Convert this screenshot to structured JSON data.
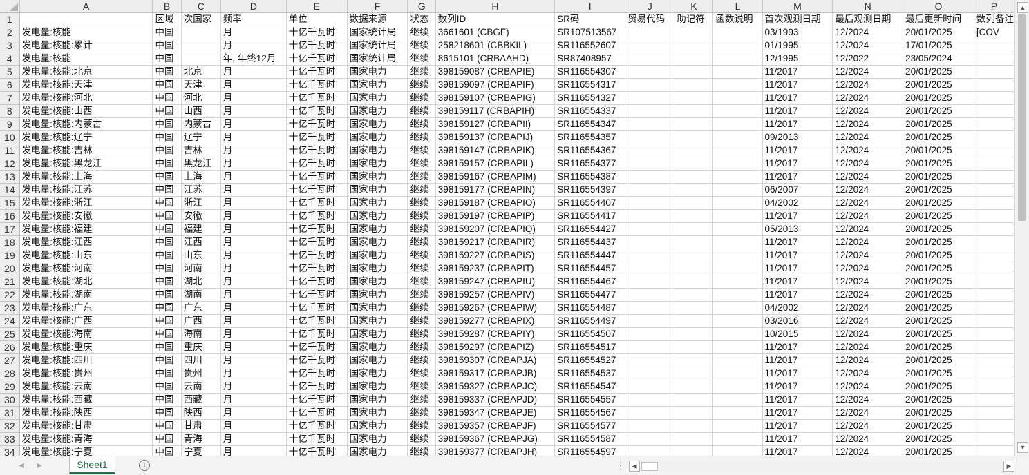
{
  "columns": [
    "A",
    "B",
    "C",
    "D",
    "E",
    "F",
    "G",
    "H",
    "I",
    "J",
    "K",
    "L",
    "M",
    "N",
    "O",
    "P"
  ],
  "rows": [
    [
      "",
      "区域",
      "次国家",
      "频率",
      "单位",
      "数据来源",
      "状态",
      "数列ID",
      "SR码",
      "贸易代码",
      "助记符",
      "函数说明",
      "首次观测日期",
      "最后观测日期",
      "最后更新时间",
      "数列备注"
    ],
    [
      "发电量:核能",
      "中国",
      "",
      "月",
      "十亿千瓦时",
      "国家统计局",
      "继续",
      "3661601 (CBGF)",
      "SR107513567",
      "",
      "",
      "",
      "03/1993",
      "12/2024",
      "20/01/2025",
      "[COV"
    ],
    [
      "发电量:核能:累计",
      "中国",
      "",
      "月",
      "十亿千瓦时",
      "国家统计局",
      "继续",
      "258218601 (CBBKIL)",
      "SR116552607",
      "",
      "",
      "",
      "01/1995",
      "12/2024",
      "17/01/2025",
      ""
    ],
    [
      "发电量:核能",
      "中国",
      "",
      "年, 年终12月",
      "十亿千瓦时",
      "国家统计局",
      "继续",
      "8615101 (CRBAAHD)",
      "SR87408957",
      "",
      "",
      "",
      "12/1995",
      "12/2022",
      "23/05/2024",
      ""
    ],
    [
      "发电量:核能:北京",
      "中国",
      "北京",
      "月",
      "十亿千瓦时",
      "国家电力",
      "继续",
      "398159087 (CRBAPIE)",
      "SR116554307",
      "",
      "",
      "",
      "11/2017",
      "12/2024",
      "20/01/2025",
      ""
    ],
    [
      "发电量:核能:天津",
      "中国",
      "天津",
      "月",
      "十亿千瓦时",
      "国家电力",
      "继续",
      "398159097 (CRBAPIF)",
      "SR116554317",
      "",
      "",
      "",
      "11/2017",
      "12/2024",
      "20/01/2025",
      ""
    ],
    [
      "发电量:核能:河北",
      "中国",
      "河北",
      "月",
      "十亿千瓦时",
      "国家电力",
      "继续",
      "398159107 (CRBAPIG)",
      "SR116554327",
      "",
      "",
      "",
      "11/2017",
      "12/2024",
      "20/01/2025",
      ""
    ],
    [
      "发电量:核能:山西",
      "中国",
      "山西",
      "月",
      "十亿千瓦时",
      "国家电力",
      "继续",
      "398159117 (CRBAPIH)",
      "SR116554337",
      "",
      "",
      "",
      "11/2017",
      "12/2024",
      "20/01/2025",
      ""
    ],
    [
      "发电量:核能:内蒙古",
      "中国",
      "内蒙古",
      "月",
      "十亿千瓦时",
      "国家电力",
      "继续",
      "398159127 (CRBAPII)",
      "SR116554347",
      "",
      "",
      "",
      "11/2017",
      "12/2024",
      "20/01/2025",
      ""
    ],
    [
      "发电量:核能:辽宁",
      "中国",
      "辽宁",
      "月",
      "十亿千瓦时",
      "国家电力",
      "继续",
      "398159137 (CRBAPIJ)",
      "SR116554357",
      "",
      "",
      "",
      "09/2013",
      "12/2024",
      "20/01/2025",
      ""
    ],
    [
      "发电量:核能:吉林",
      "中国",
      "吉林",
      "月",
      "十亿千瓦时",
      "国家电力",
      "继续",
      "398159147 (CRBAPIK)",
      "SR116554367",
      "",
      "",
      "",
      "11/2017",
      "12/2024",
      "20/01/2025",
      ""
    ],
    [
      "发电量:核能:黑龙江",
      "中国",
      "黑龙江",
      "月",
      "十亿千瓦时",
      "国家电力",
      "继续",
      "398159157 (CRBAPIL)",
      "SR116554377",
      "",
      "",
      "",
      "11/2017",
      "12/2024",
      "20/01/2025",
      ""
    ],
    [
      "发电量:核能:上海",
      "中国",
      "上海",
      "月",
      "十亿千瓦时",
      "国家电力",
      "继续",
      "398159167 (CRBAPIM)",
      "SR116554387",
      "",
      "",
      "",
      "11/2017",
      "12/2024",
      "20/01/2025",
      ""
    ],
    [
      "发电量:核能:江苏",
      "中国",
      "江苏",
      "月",
      "十亿千瓦时",
      "国家电力",
      "继续",
      "398159177 (CRBAPIN)",
      "SR116554397",
      "",
      "",
      "",
      "06/2007",
      "12/2024",
      "20/01/2025",
      ""
    ],
    [
      "发电量:核能:浙江",
      "中国",
      "浙江",
      "月",
      "十亿千瓦时",
      "国家电力",
      "继续",
      "398159187 (CRBAPIO)",
      "SR116554407",
      "",
      "",
      "",
      "04/2002",
      "12/2024",
      "20/01/2025",
      ""
    ],
    [
      "发电量:核能:安徽",
      "中国",
      "安徽",
      "月",
      "十亿千瓦时",
      "国家电力",
      "继续",
      "398159197 (CRBAPIP)",
      "SR116554417",
      "",
      "",
      "",
      "11/2017",
      "12/2024",
      "20/01/2025",
      ""
    ],
    [
      "发电量:核能:福建",
      "中国",
      "福建",
      "月",
      "十亿千瓦时",
      "国家电力",
      "继续",
      "398159207 (CRBAPIQ)",
      "SR116554427",
      "",
      "",
      "",
      "05/2013",
      "12/2024",
      "20/01/2025",
      ""
    ],
    [
      "发电量:核能:江西",
      "中国",
      "江西",
      "月",
      "十亿千瓦时",
      "国家电力",
      "继续",
      "398159217 (CRBAPIR)",
      "SR116554437",
      "",
      "",
      "",
      "11/2017",
      "12/2024",
      "20/01/2025",
      ""
    ],
    [
      "发电量:核能:山东",
      "中国",
      "山东",
      "月",
      "十亿千瓦时",
      "国家电力",
      "继续",
      "398159227 (CRBAPIS)",
      "SR116554447",
      "",
      "",
      "",
      "11/2017",
      "12/2024",
      "20/01/2025",
      ""
    ],
    [
      "发电量:核能:河南",
      "中国",
      "河南",
      "月",
      "十亿千瓦时",
      "国家电力",
      "继续",
      "398159237 (CRBAPIT)",
      "SR116554457",
      "",
      "",
      "",
      "11/2017",
      "12/2024",
      "20/01/2025",
      ""
    ],
    [
      "发电量:核能:湖北",
      "中国",
      "湖北",
      "月",
      "十亿千瓦时",
      "国家电力",
      "继续",
      "398159247 (CRBAPIU)",
      "SR116554467",
      "",
      "",
      "",
      "11/2017",
      "12/2024",
      "20/01/2025",
      ""
    ],
    [
      "发电量:核能:湖南",
      "中国",
      "湖南",
      "月",
      "十亿千瓦时",
      "国家电力",
      "继续",
      "398159257 (CRBAPIV)",
      "SR116554477",
      "",
      "",
      "",
      "11/2017",
      "12/2024",
      "20/01/2025",
      ""
    ],
    [
      "发电量:核能:广东",
      "中国",
      "广东",
      "月",
      "十亿千瓦时",
      "国家电力",
      "继续",
      "398159267 (CRBAPIW)",
      "SR116554487",
      "",
      "",
      "",
      "04/2002",
      "12/2024",
      "20/01/2025",
      ""
    ],
    [
      "发电量:核能:广西",
      "中国",
      "广西",
      "月",
      "十亿千瓦时",
      "国家电力",
      "继续",
      "398159277 (CRBAPIX)",
      "SR116554497",
      "",
      "",
      "",
      "03/2016",
      "12/2024",
      "20/01/2025",
      ""
    ],
    [
      "发电量:核能:海南",
      "中国",
      "海南",
      "月",
      "十亿千瓦时",
      "国家电力",
      "继续",
      "398159287 (CRBAPIY)",
      "SR116554507",
      "",
      "",
      "",
      "10/2015",
      "12/2024",
      "20/01/2025",
      ""
    ],
    [
      "发电量:核能:重庆",
      "中国",
      "重庆",
      "月",
      "十亿千瓦时",
      "国家电力",
      "继续",
      "398159297 (CRBAPIZ)",
      "SR116554517",
      "",
      "",
      "",
      "11/2017",
      "12/2024",
      "20/01/2025",
      ""
    ],
    [
      "发电量:核能:四川",
      "中国",
      "四川",
      "月",
      "十亿千瓦时",
      "国家电力",
      "继续",
      "398159307 (CRBAPJA)",
      "SR116554527",
      "",
      "",
      "",
      "11/2017",
      "12/2024",
      "20/01/2025",
      ""
    ],
    [
      "发电量:核能:贵州",
      "中国",
      "贵州",
      "月",
      "十亿千瓦时",
      "国家电力",
      "继续",
      "398159317 (CRBAPJB)",
      "SR116554537",
      "",
      "",
      "",
      "11/2017",
      "12/2024",
      "20/01/2025",
      ""
    ],
    [
      "发电量:核能:云南",
      "中国",
      "云南",
      "月",
      "十亿千瓦时",
      "国家电力",
      "继续",
      "398159327 (CRBAPJC)",
      "SR116554547",
      "",
      "",
      "",
      "11/2017",
      "12/2024",
      "20/01/2025",
      ""
    ],
    [
      "发电量:核能:西藏",
      "中国",
      "西藏",
      "月",
      "十亿千瓦时",
      "国家电力",
      "继续",
      "398159337 (CRBAPJD)",
      "SR116554557",
      "",
      "",
      "",
      "11/2017",
      "12/2024",
      "20/01/2025",
      ""
    ],
    [
      "发电量:核能:陕西",
      "中国",
      "陕西",
      "月",
      "十亿千瓦时",
      "国家电力",
      "继续",
      "398159347 (CRBAPJE)",
      "SR116554567",
      "",
      "",
      "",
      "11/2017",
      "12/2024",
      "20/01/2025",
      ""
    ],
    [
      "发电量:核能:甘肃",
      "中国",
      "甘肃",
      "月",
      "十亿千瓦时",
      "国家电力",
      "继续",
      "398159357 (CRBAPJF)",
      "SR116554577",
      "",
      "",
      "",
      "11/2017",
      "12/2024",
      "20/01/2025",
      ""
    ],
    [
      "发电量:核能:青海",
      "中国",
      "青海",
      "月",
      "十亿千瓦时",
      "国家电力",
      "继续",
      "398159367 (CRBAPJG)",
      "SR116554587",
      "",
      "",
      "",
      "11/2017",
      "12/2024",
      "20/01/2025",
      ""
    ],
    [
      "发电量:核能:宁夏",
      "中国",
      "宁夏",
      "月",
      "十亿千瓦时",
      "国家电力",
      "继续",
      "398159377 (CRBAPJH)",
      "SR116554597",
      "",
      "",
      "",
      "11/2017",
      "12/2024",
      "20/01/2025",
      ""
    ]
  ],
  "sheet_tab": "Sheet1",
  "add_sheet_symbol": "+",
  "nav": {
    "prev": "◀",
    "next": "▶"
  },
  "scroll": {
    "up": "▲",
    "down": "▼",
    "left": "◀",
    "right": "▶"
  },
  "split_symbol": "⋮",
  "colors": {
    "accent": "#1e7145",
    "header_bg": "#ededed",
    "grid": "#d4d4d4"
  }
}
